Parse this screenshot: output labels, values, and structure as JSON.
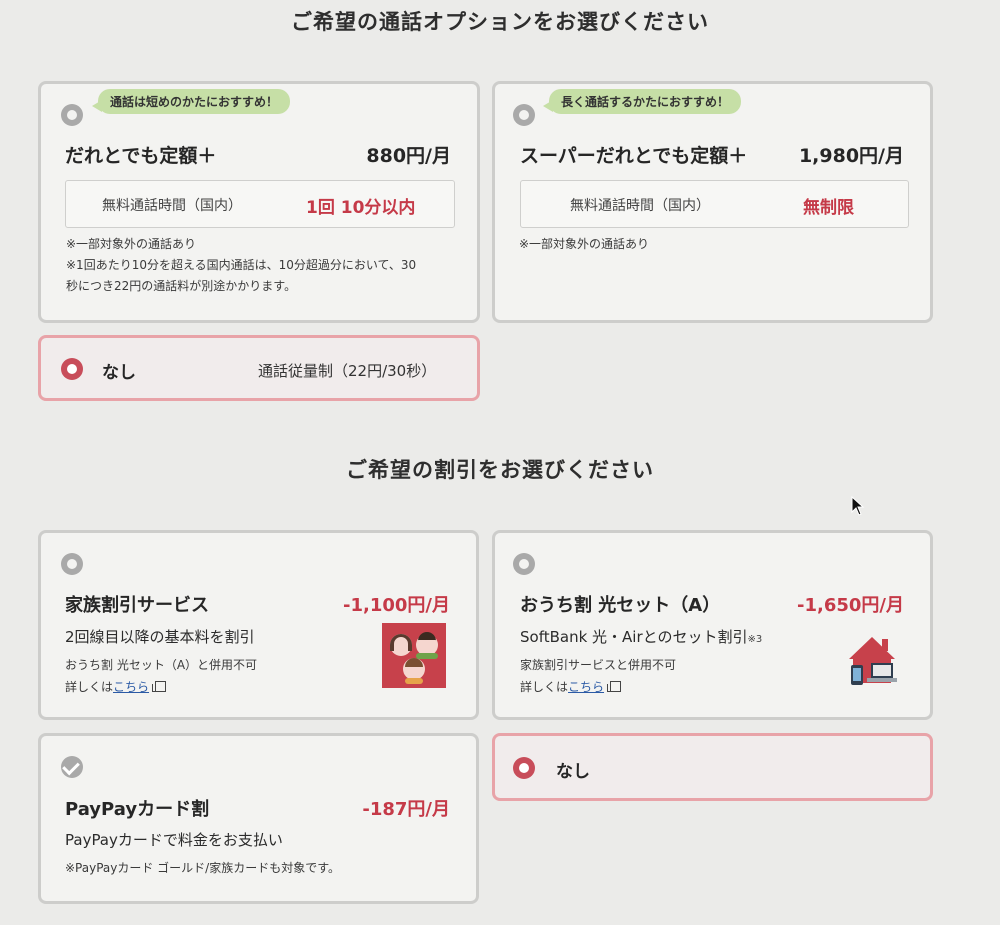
{
  "call_section": {
    "title": "ご希望の通話オプションをお選びください",
    "options": [
      {
        "badge": "通話は短めのかたにおすすめ！",
        "name": "だれとでも定額＋",
        "price": "880円/月",
        "info_label": "無料通話時間（国内）",
        "info_value": "1回 10分以内",
        "notes": [
          "※一部対象外の通話あり",
          "※1回あたり10分を超える国内通話は、10分超過分において、30",
          "秒につき22円の通話料が別途かかります。"
        ]
      },
      {
        "badge": "長く通話するかたにおすすめ！",
        "name": "スーパーだれとでも定額＋",
        "price": "1,980円/月",
        "info_label": "無料通話時間（国内）",
        "info_value": "無制限",
        "notes": [
          "※一部対象外の通話あり"
        ]
      }
    ],
    "none": {
      "label": "なし",
      "detail": "通話従量制（22円/30秒）"
    }
  },
  "discount_section": {
    "title": "ご希望の割引をお選びください",
    "family": {
      "name": "家族割引サービス",
      "price": "-1,100円/月",
      "desc": "2回線目以降の基本料を割引",
      "note": "おうち割 光セット（A）と併用不可",
      "detail_prefix": "詳しくは",
      "link": "こちら"
    },
    "home": {
      "name": "おうち割 光セット（A）",
      "price": "-1,650円/月",
      "desc": "SoftBank 光・Airとのセット割引",
      "desc_mark": "※3",
      "note": "家族割引サービスと併用不可",
      "detail_prefix": "詳しくは",
      "link": "こちら"
    },
    "paypay": {
      "name": "PayPayカード割",
      "price": "-187円/月",
      "desc": "PayPayカードで料金をお支払い",
      "note": "※PayPayカード ゴールド/家族カードも対象です。"
    },
    "none": {
      "label": "なし"
    }
  },
  "colors": {
    "accent": "#c53a48",
    "selected_border": "#e8a3a8",
    "badge": "#c6dfa6"
  },
  "icons": [
    "radio-icon",
    "family-illustration-icon",
    "home-devices-icon",
    "external-link-icon",
    "checkmark-icon",
    "mouse-cursor-icon"
  ]
}
